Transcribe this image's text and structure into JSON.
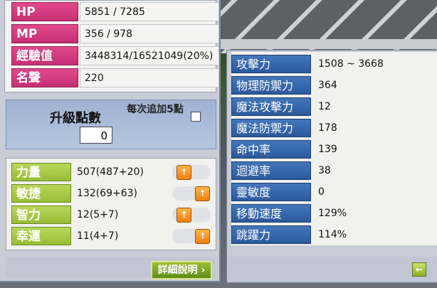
{
  "basic_stats": [
    {
      "label": "HP",
      "value": "5851 / 7285"
    },
    {
      "label": "MP",
      "value": "356 / 978"
    },
    {
      "label": "經驗值",
      "value": "3448314/16521049(20%)"
    },
    {
      "label": "名聲",
      "value": "220"
    }
  ],
  "ability_points": {
    "title": "升級點數",
    "value": "0",
    "auto_label": "每次追加5點"
  },
  "attributes": [
    {
      "label": "力量",
      "value": "507(487+20)"
    },
    {
      "label": "敏捷",
      "value": "132(69+63)"
    },
    {
      "label": "智力",
      "value": "12(5+7)"
    },
    {
      "label": "幸運",
      "value": "11(4+7)"
    }
  ],
  "detail_button": "詳細說明",
  "detail_stats": [
    {
      "label": "攻擊力",
      "value": "1508 ~ 3668"
    },
    {
      "label": "物理防禦力",
      "value": "364"
    },
    {
      "label": "魔法攻擊力",
      "value": "12"
    },
    {
      "label": "魔法防禦力",
      "value": "178"
    },
    {
      "label": "命中率",
      "value": "139"
    },
    {
      "label": "迴避率",
      "value": "38"
    },
    {
      "label": "靈敏度",
      "value": "0"
    },
    {
      "label": "移動速度",
      "value": "129%"
    },
    {
      "label": "跳躍力",
      "value": "114%"
    }
  ],
  "icons": {
    "plus": "plus-icon",
    "back": "back-arrow-icon"
  },
  "colors": {
    "basic_label": "#d93a80",
    "attribute_label": "#a8c843",
    "detail_label": "#3b6daf",
    "orange_button": "#f58a17"
  }
}
